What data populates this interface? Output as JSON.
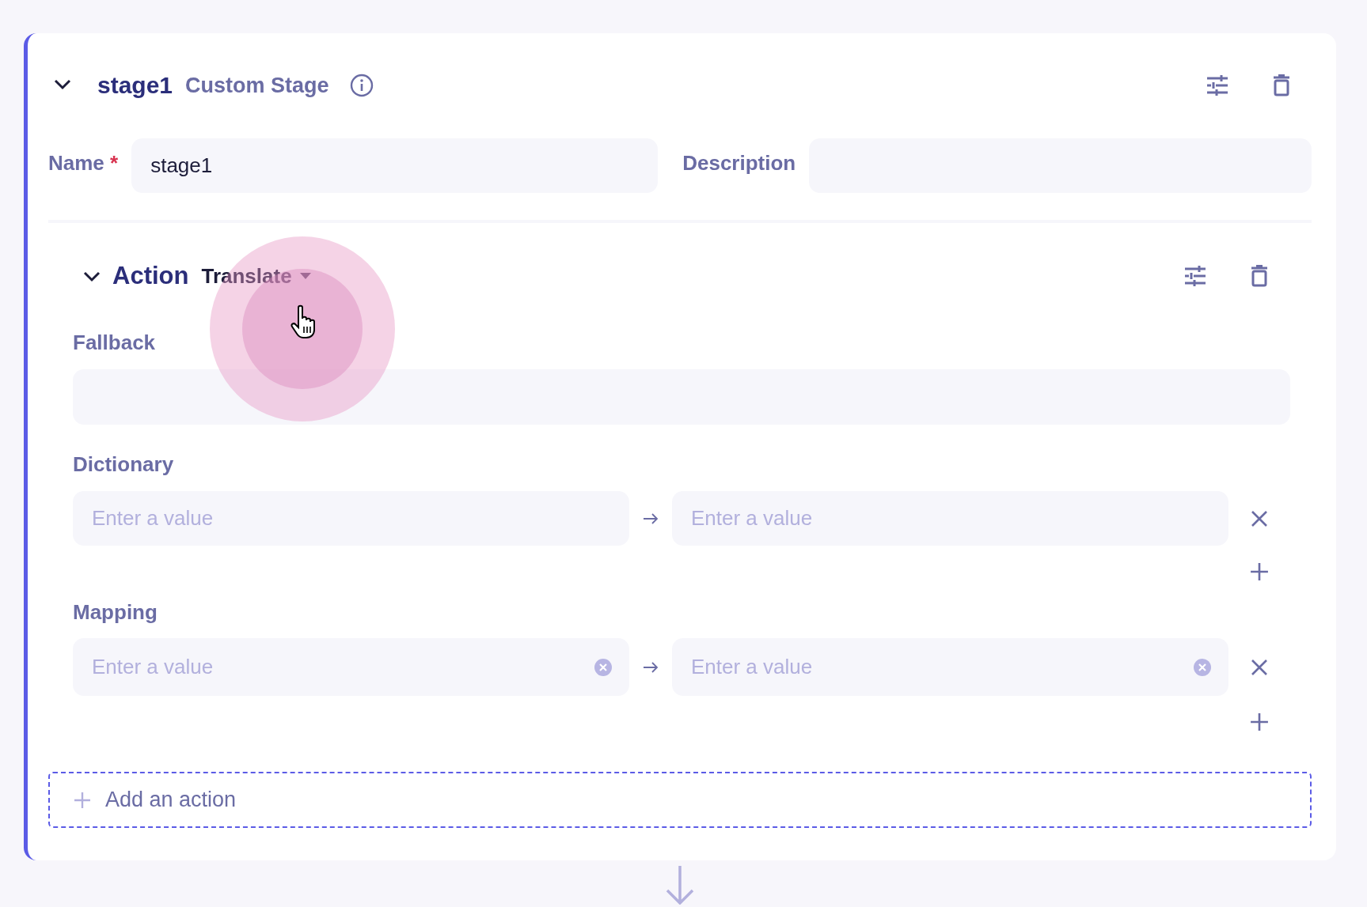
{
  "stage": {
    "expanded": true,
    "name": "stage1",
    "type": "Custom Stage",
    "fields": [
      {
        "label": "Name",
        "required_mark": "*",
        "value": "stage1"
      },
      {
        "label": "Description"
      }
    ]
  },
  "action": {
    "expanded": true,
    "label": "Action",
    "type": "Translate",
    "fallback": {
      "label": "Fallback"
    },
    "sections": [
      {
        "label": "Dictionary",
        "rows": [
          {
            "key_placeholder": "Enter a value",
            "value_placeholder": "Enter a value",
            "clearable": false
          }
        ]
      },
      {
        "label": "Mapping",
        "rows": [
          {
            "key_placeholder": "Enter a value",
            "value_placeholder": "Enter a value",
            "clearable": true
          }
        ]
      }
    ]
  },
  "add_action": {
    "label": "Add an action"
  }
}
